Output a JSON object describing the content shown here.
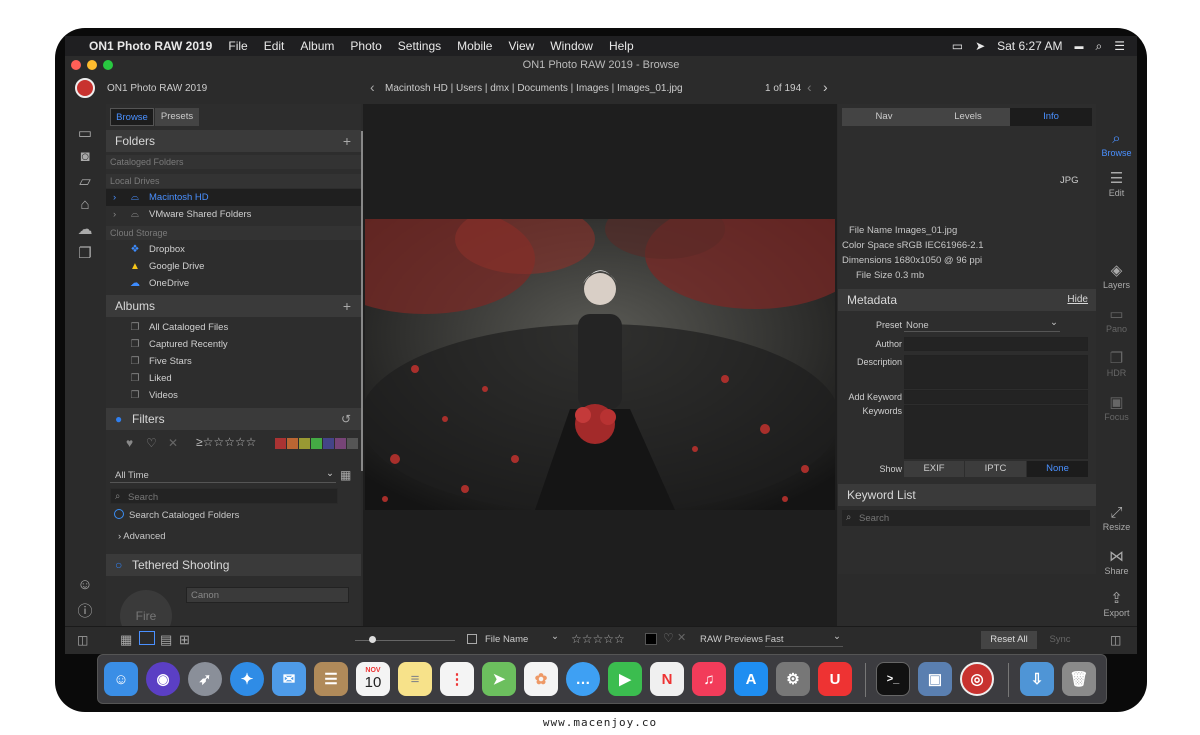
{
  "menubar": {
    "apple": "",
    "app": "ON1 Photo RAW 2019",
    "items": [
      "File",
      "Edit",
      "Album",
      "Photo",
      "Settings",
      "Mobile",
      "View",
      "Window",
      "Help"
    ],
    "clock": "Sat 6:27 AM"
  },
  "window": {
    "title": "ON1 Photo RAW 2019 - Browse"
  },
  "topbar": {
    "app_name": "ON1 Photo RAW 2019",
    "breadcrumb": [
      "Macintosh HD",
      "Users",
      "dmx",
      "Documents",
      "Images",
      "Images_01.jpg"
    ],
    "counter": "1 of 194"
  },
  "left": {
    "tabs": [
      "Browse",
      "Presets"
    ],
    "folders_title": "Folders",
    "cataloged": "Cataloged Folders",
    "local": "Local Drives",
    "drives": [
      "Macintosh HD",
      "VMware Shared Folders"
    ],
    "cloud": "Cloud Storage",
    "cloud_items": [
      "Dropbox",
      "Google Drive",
      "OneDrive"
    ],
    "albums_title": "Albums",
    "albums": [
      "All Cataloged Files",
      "Captured Recently",
      "Five Stars",
      "Liked",
      "Videos"
    ],
    "filters_title": "Filters",
    "stars": "≥☆☆☆☆☆",
    "time": "All Time",
    "search_placeholder": "Search",
    "search_cataloged": "Search Cataloged Folders",
    "advanced": "Advanced",
    "tethered_title": "Tethered Shooting",
    "fire": "Fire",
    "camera": "Canon"
  },
  "right": {
    "tabs": [
      "Nav",
      "Levels",
      "Info"
    ],
    "format": "JPG",
    "info": [
      "File Name Images_01.jpg",
      "Color Space sRGB IEC61966-2.1",
      "Dimensions 1680x1050 @ 96 ppi",
      "File Size 0.3 mb"
    ],
    "metadata_title": "Metadata",
    "hide": "Hide",
    "preset_label": "Preset",
    "preset_value": "None",
    "author": "Author",
    "description": "Description",
    "add_keyword": "Add Keyword",
    "keywords": "Keywords",
    "show": "Show",
    "show_opts": [
      "EXIF",
      "IPTC",
      "None"
    ],
    "keyword_list": "Keyword List",
    "kw_search": "Search"
  },
  "rail": [
    "Browse",
    "Edit",
    "Layers",
    "Pano",
    "HDR",
    "Focus",
    "Resize",
    "Share",
    "Export"
  ],
  "bottom": {
    "sort": "File Name",
    "stars": "☆☆☆☆☆",
    "raw_label": "RAW Previews",
    "raw_value": "Fast",
    "reset": "Reset All",
    "sync": "Sync"
  },
  "dock": {
    "cal_month": "NOV",
    "cal_day": "10"
  },
  "footer": "www.macenjoy.co",
  "colors": {
    "accent": "#2f7ff0",
    "panel": "#2d2d2d",
    "header": "#3a3a3a"
  }
}
